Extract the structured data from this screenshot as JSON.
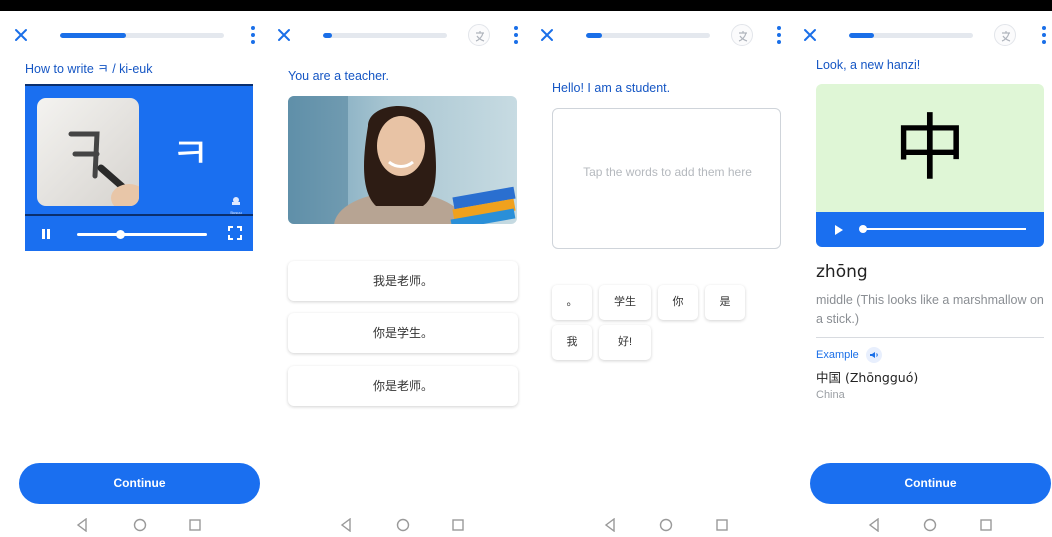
{
  "colors": {
    "accent": "#1a6fe8",
    "prompt": "#1556c4",
    "hanzi_bg": "#dff6d6"
  },
  "screens": [
    {
      "progress": 0.4,
      "prompt": "How to write ㅋ / ki-euk",
      "video_glyph": "ㅋ",
      "logo_text": "Busuu",
      "scrub": 0.33,
      "continue_label": "Continue"
    },
    {
      "progress": 0.07,
      "prompt": "You are a teacher.",
      "options": [
        "我是老师。",
        "你是学生。",
        "你是老师。"
      ]
    },
    {
      "progress": 0.13,
      "prompt": "Hello! I am a student.",
      "answer_placeholder": "Tap the words to add them here",
      "tiles": [
        "。",
        "学生",
        "你",
        "是",
        "我",
        "好!"
      ]
    },
    {
      "progress": 0.2,
      "prompt": "Look, a new hanzi!",
      "hanzi": "中",
      "pinyin": "zhōng",
      "meaning": "middle (This looks like a marshmallow on a stick.)",
      "example_label": "Example",
      "example_hanzi": "中国 (Zhōngguó)",
      "example_translation": "China",
      "continue_label": "Continue"
    }
  ]
}
